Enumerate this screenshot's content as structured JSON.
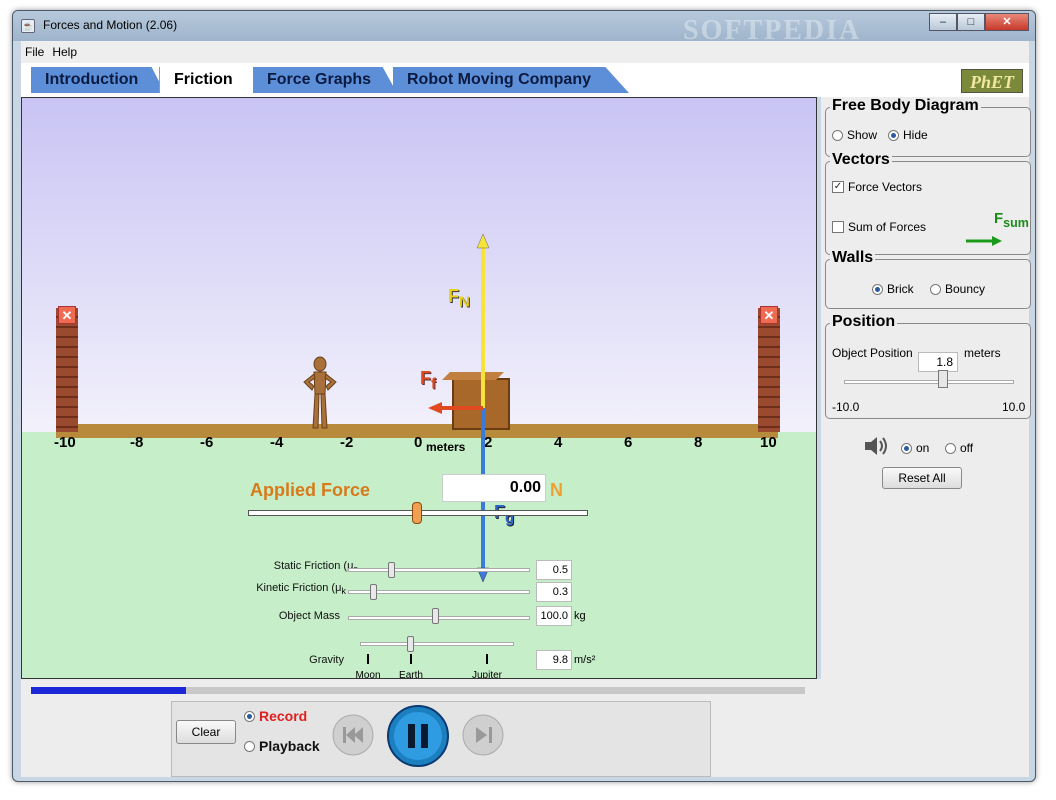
{
  "window": {
    "title": "Forces and Motion (2.06)",
    "watermark": "SOFTPEDIA",
    "min": "–",
    "max": "□",
    "close": "✕"
  },
  "menu": [
    "File",
    "Help"
  ],
  "tabs": [
    {
      "label": "Introduction",
      "active": false
    },
    {
      "label": "Friction",
      "active": true
    },
    {
      "label": "Force Graphs",
      "active": false
    },
    {
      "label": "Robot Moving Company",
      "active": false
    }
  ],
  "logo": "PhET",
  "ruler": {
    "ticks": [
      "-10",
      "-8",
      "-6",
      "-4",
      "-2",
      "0",
      "2",
      "4",
      "6",
      "8",
      "10"
    ],
    "unit": "meters"
  },
  "forces": {
    "normal": [
      "F",
      "N"
    ],
    "friction": [
      "F",
      "f"
    ],
    "gravity": [
      "F",
      "g"
    ]
  },
  "applied": {
    "label": "Applied Force",
    "value": "0.00",
    "unit": "N"
  },
  "params": {
    "static": {
      "label": "Static Friction (μ",
      "sub": "s",
      "value": "0.5"
    },
    "kinetic": {
      "label": "Kinetic Friction (μ",
      "sub": "k",
      "value": "0.3"
    },
    "mass": {
      "label": "Object Mass",
      "value": "100.0",
      "unit": "kg"
    },
    "gravity": {
      "label": "Gravity",
      "value": "9.8",
      "unit": "m/s²",
      "planets": [
        "Moon",
        "Earth",
        "Jupiter"
      ]
    }
  },
  "panel": {
    "fbd": {
      "title": "Free Body Diagram",
      "show": "Show",
      "hide": "Hide"
    },
    "vectors": {
      "title": "Vectors",
      "force": "Force Vectors",
      "sum": "Sum of Forces",
      "fsum": [
        "F",
        "sum"
      ]
    },
    "walls": {
      "title": "Walls",
      "brick": "Brick",
      "bouncy": "Bouncy"
    },
    "position": {
      "title": "Position",
      "label": "Object Position",
      "value": "1.8",
      "unit": "meters",
      "min": "-10.0",
      "max": "10.0"
    },
    "sound": {
      "on": "on",
      "off": "off"
    },
    "reset": "Reset All"
  },
  "playback": {
    "clear": "Clear",
    "record": "Record",
    "playback": "Playback",
    "progress": 0.2
  }
}
